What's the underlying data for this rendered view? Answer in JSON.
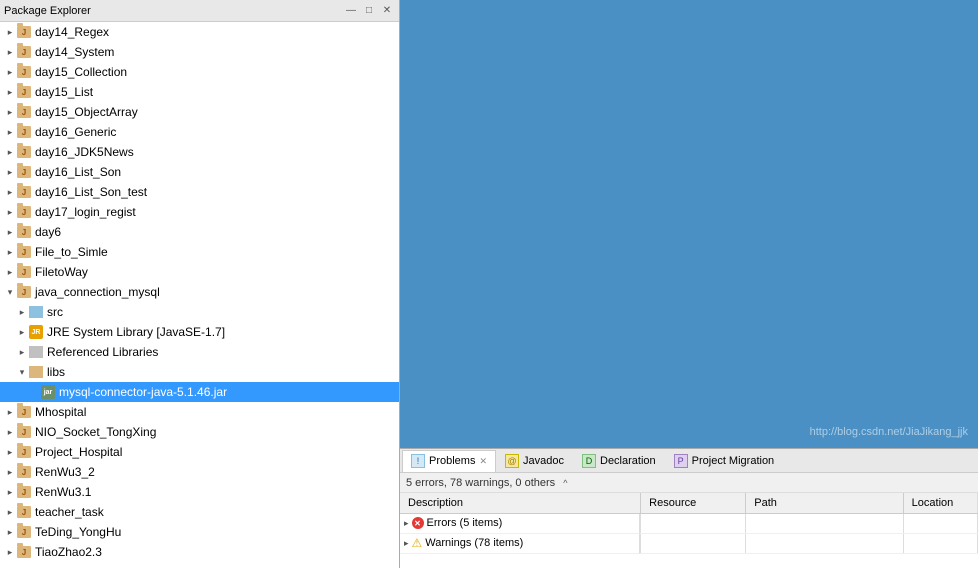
{
  "packageExplorer": {
    "title": "Package Explorer",
    "items": [
      {
        "id": "day14_Regex",
        "label": "day14_Regex",
        "type": "project",
        "indent": 0,
        "expanded": false
      },
      {
        "id": "day14_System",
        "label": "day14_System",
        "type": "project",
        "indent": 0,
        "expanded": false
      },
      {
        "id": "day15_Collection",
        "label": "day15_Collection",
        "type": "project",
        "indent": 0,
        "expanded": false
      },
      {
        "id": "day15_List",
        "label": "day15_List",
        "type": "project",
        "indent": 0,
        "expanded": false
      },
      {
        "id": "day15_ObjectArray",
        "label": "day15_ObjectArray",
        "type": "project",
        "indent": 0,
        "expanded": false
      },
      {
        "id": "day16_Generic",
        "label": "day16_Generic",
        "type": "project",
        "indent": 0,
        "expanded": false
      },
      {
        "id": "day16_JDK5News",
        "label": "day16_JDK5News",
        "type": "project",
        "indent": 0,
        "expanded": false
      },
      {
        "id": "day16_List_Son",
        "label": "day16_List_Son",
        "type": "project",
        "indent": 0,
        "expanded": false
      },
      {
        "id": "day16_List_Son_test",
        "label": "day16_List_Son_test",
        "type": "project",
        "indent": 0,
        "expanded": false
      },
      {
        "id": "day17_login_regist",
        "label": "day17_login_regist",
        "type": "project",
        "indent": 0,
        "expanded": false
      },
      {
        "id": "day6",
        "label": "day6",
        "type": "project",
        "indent": 0,
        "expanded": false
      },
      {
        "id": "File_to_Simle",
        "label": "File_to_Simle",
        "type": "project",
        "indent": 0,
        "expanded": false
      },
      {
        "id": "FiletoWay",
        "label": "FiletoWay",
        "type": "project",
        "indent": 0,
        "expanded": false
      },
      {
        "id": "java_connection_mysql",
        "label": "java_connection_mysql",
        "type": "project",
        "indent": 0,
        "expanded": true
      },
      {
        "id": "src",
        "label": "src",
        "type": "src",
        "indent": 1,
        "expanded": false
      },
      {
        "id": "jre",
        "label": "JRE System Library [JavaSE-1.7]",
        "type": "jre",
        "indent": 1,
        "expanded": false
      },
      {
        "id": "reflibrary",
        "label": "Referenced Libraries",
        "type": "reflibrary",
        "indent": 1,
        "expanded": false
      },
      {
        "id": "libs",
        "label": "libs",
        "type": "libs",
        "indent": 1,
        "expanded": true
      },
      {
        "id": "mysql_jar",
        "label": "mysql-connector-java-5.1.46.jar",
        "type": "jar",
        "indent": 2,
        "expanded": false,
        "selected": true
      },
      {
        "id": "Mhospital",
        "label": "Mhospital",
        "type": "project",
        "indent": 0,
        "expanded": false
      },
      {
        "id": "NIO_Socket_TongXing",
        "label": "NIO_Socket_TongXing",
        "type": "project",
        "indent": 0,
        "expanded": false
      },
      {
        "id": "Project_Hospital",
        "label": "Project_Hospital",
        "type": "project",
        "indent": 0,
        "expanded": false
      },
      {
        "id": "RenWu3_2",
        "label": "RenWu3_2",
        "type": "project",
        "indent": 0,
        "expanded": false
      },
      {
        "id": "RenWu3.1",
        "label": "RenWu3.1",
        "type": "project",
        "indent": 0,
        "expanded": false
      },
      {
        "id": "teacher_task",
        "label": "teacher_task",
        "type": "project",
        "indent": 0,
        "expanded": false
      },
      {
        "id": "TeDing_YongHu",
        "label": "TeDing_YongHu",
        "type": "project",
        "indent": 0,
        "expanded": false
      },
      {
        "id": "TiaoZhao2.3",
        "label": "TiaoZhao2.3",
        "type": "project",
        "indent": 0,
        "expanded": false
      }
    ]
  },
  "bottomPanel": {
    "tabs": [
      {
        "id": "problems",
        "label": "Problems",
        "active": true,
        "hasClose": true,
        "iconType": "problems"
      },
      {
        "id": "javadoc",
        "label": "Javadoc",
        "active": false,
        "hasClose": false,
        "iconType": "javadoc"
      },
      {
        "id": "declaration",
        "label": "Declaration",
        "active": false,
        "hasClose": false,
        "iconType": "declaration"
      },
      {
        "id": "migration",
        "label": "Project Migration",
        "active": false,
        "hasClose": false,
        "iconType": "migration"
      }
    ],
    "statusText": "5 errors, 78 warnings, 0 others",
    "collapseHint": "^",
    "table": {
      "headers": [
        "Description",
        "Resource",
        "Path",
        "Location"
      ],
      "rows": [
        {
          "type": "error",
          "description": "Errors (5 items)",
          "resource": "",
          "path": "",
          "location": "",
          "expandable": true
        },
        {
          "type": "warning",
          "description": "Warnings (78 items)",
          "resource": "",
          "path": "",
          "location": "",
          "expandable": true
        }
      ]
    }
  },
  "watermark": "http://blog.csdn.net/JiaJikang_jjk"
}
